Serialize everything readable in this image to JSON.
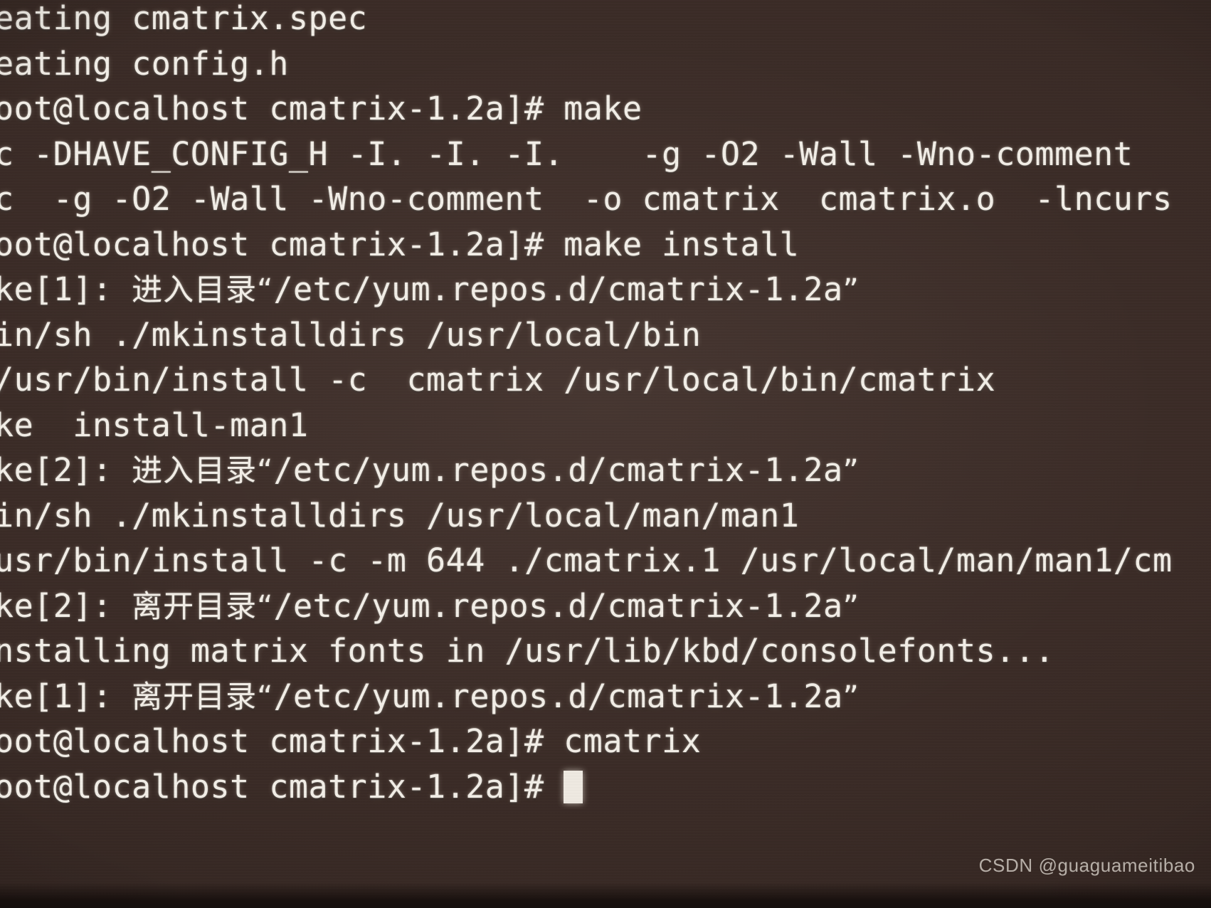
{
  "terminal": {
    "background_color": "#3a2b26",
    "text_color": "#f3efe8",
    "prompt_suffix": "]# ",
    "cursor": "block",
    "lines": [
      {
        "id": "l01",
        "text": "eating cmatrix.spec"
      },
      {
        "id": "l02",
        "text": "eating config.h"
      },
      {
        "id": "l03",
        "text": "oot@localhost cmatrix-1.2a]# make"
      },
      {
        "id": "l04",
        "text": "c -DHAVE_CONFIG_H -I. -I. -I.    -g -O2 -Wall -Wno-comment"
      },
      {
        "id": "l05",
        "text": "c  -g -O2 -Wall -Wno-comment  -o cmatrix  cmatrix.o  -lncurs"
      },
      {
        "id": "l06",
        "text": "oot@localhost cmatrix-1.2a]# make install"
      },
      {
        "id": "l07",
        "text": "ke[1]: 进入目录“/etc/yum.repos.d/cmatrix-1.2a”"
      },
      {
        "id": "l08",
        "text": "in/sh ./mkinstalldirs /usr/local/bin"
      },
      {
        "id": "l09",
        "text": "/usr/bin/install -c  cmatrix /usr/local/bin/cmatrix"
      },
      {
        "id": "l10",
        "text": "ke  install-man1"
      },
      {
        "id": "l11",
        "text": "ke[2]: 进入目录“/etc/yum.repos.d/cmatrix-1.2a”"
      },
      {
        "id": "l12",
        "text": "in/sh ./mkinstalldirs /usr/local/man/man1"
      },
      {
        "id": "l13",
        "text": "usr/bin/install -c -m 644 ./cmatrix.1 /usr/local/man/man1/cm"
      },
      {
        "id": "l14",
        "text": "ke[2]: 离开目录“/etc/yum.repos.d/cmatrix-1.2a”"
      },
      {
        "id": "l15",
        "text": "nstalling matrix fonts in /usr/lib/kbd/consolefonts..."
      },
      {
        "id": "l16",
        "text": "ke[1]: 离开目录“/etc/yum.repos.d/cmatrix-1.2a”"
      },
      {
        "id": "l17",
        "text": "oot@localhost cmatrix-1.2a]# cmatrix"
      },
      {
        "id": "l18",
        "text": "oot@localhost cmatrix-1.2a]# "
      }
    ]
  },
  "watermark": {
    "text": "CSDN @guaguameitibao"
  }
}
